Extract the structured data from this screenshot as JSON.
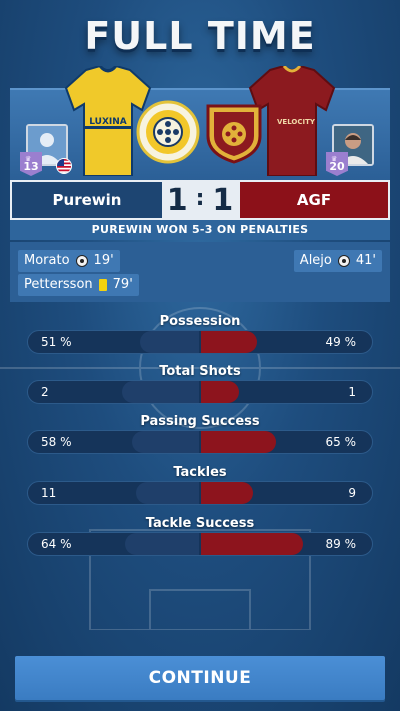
{
  "screen": {
    "title": "FULL TIME"
  },
  "home": {
    "team": "Purewin",
    "score": "1",
    "level": "13",
    "kit_color": "#f0c92a",
    "kit_sponsor": "LUXINA",
    "flag": "us-flag-icon"
  },
  "away": {
    "team": "AGF",
    "score": "1",
    "level": "20",
    "kit_color": "#8c1a1f",
    "kit_sponsor": "VELOCITY"
  },
  "penalties_text": "PUREWIN WON 5-3 ON PENALTIES",
  "events": {
    "home": [
      {
        "player": "Morato",
        "minute": "19'",
        "icon": "goal-ball-icon"
      },
      {
        "player": "Pettersson",
        "minute": "79'",
        "icon": "yellow-card-icon"
      }
    ],
    "away": [
      {
        "player": "Alejo",
        "minute": "41'",
        "icon": "goal-ball-icon"
      }
    ]
  },
  "stats": [
    {
      "label": "Possession",
      "home": "51 %",
      "away": "49 %",
      "home_share": 0.51,
      "away_share": 0.49
    },
    {
      "label": "Total Shots",
      "home": "2",
      "away": "1",
      "home_share": 0.67,
      "away_share": 0.33
    },
    {
      "label": "Passing Success",
      "home": "58 %",
      "away": "65 %",
      "home_share": 0.58,
      "away_share": 0.65
    },
    {
      "label": "Tackles",
      "home": "11",
      "away": "9",
      "home_share": 0.55,
      "away_share": 0.45
    },
    {
      "label": "Tackle Success",
      "home": "64 %",
      "away": "89 %",
      "home_share": 0.64,
      "away_share": 0.89
    }
  ],
  "continue_label": "CONTINUE",
  "colors": {
    "home_accent": "#1d4572",
    "away_accent": "#8c1119",
    "button": "#3a7cc2"
  }
}
